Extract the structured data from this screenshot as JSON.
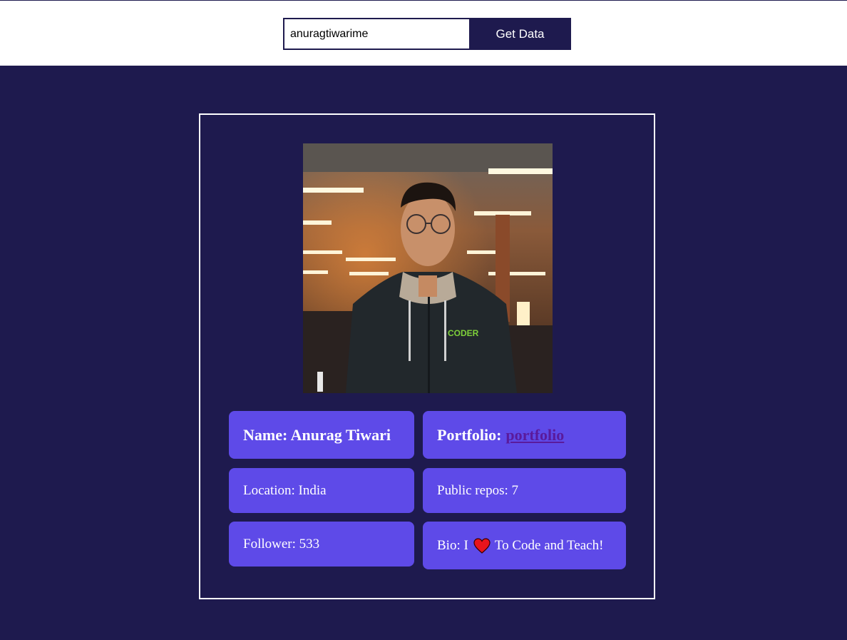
{
  "search": {
    "value": "anuragtiwarime",
    "button_label": "Get Data"
  },
  "profile": {
    "name_label": "Name: Anurag Tiwari",
    "portfolio_prefix": "Portfolio:",
    "portfolio_link_text": "portfolio",
    "location": "Location: India",
    "public_repos": "Public repos: 7",
    "followers": "Follower: 533",
    "bio_prefix": "Bio: I",
    "bio_suffix": "To Code and Teach!",
    "bio_icon": "heart-icon",
    "hoodie_text": "CODER"
  },
  "colors": {
    "page_bg": "#1e1a4e",
    "card_bg": "#5e4ae8",
    "link": "#5a1a9c",
    "heart": "#e8141c"
  }
}
